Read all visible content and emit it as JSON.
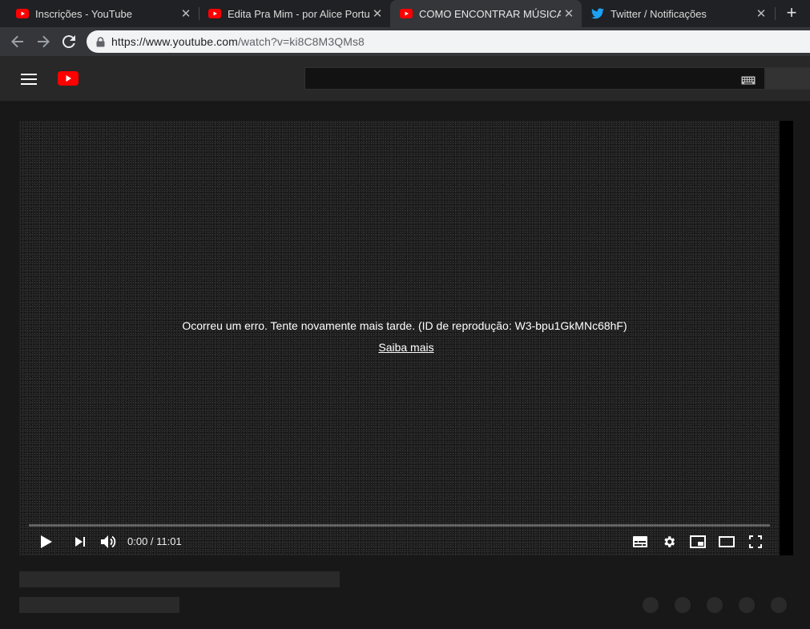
{
  "browser": {
    "tabs": [
      {
        "title": "Inscrições - YouTube",
        "icon": "youtube-icon",
        "active": false
      },
      {
        "title": "Edita Pra Mim - por Alice Portugal",
        "icon": "youtube-icon",
        "active": false
      },
      {
        "title": "COMO ENCONTRAR MÚSICAS GRÁTIS",
        "icon": "youtube-icon",
        "active": true
      },
      {
        "title": "Twitter / Notificações",
        "icon": "twitter-icon",
        "active": false
      }
    ],
    "url_host": "https://www.youtube.com",
    "url_path": "/watch?v=ki8C8M3QMs8"
  },
  "player": {
    "error_message": "Ocorreu um erro. Tente novamente mais tarde. (ID de reprodução: W3-bpu1GkMNc68hF)",
    "learn_more": "Saiba mais",
    "time": "0:00 / 11:01",
    "progress": 0
  },
  "colors": {
    "youtube_red": "#ff0000",
    "twitter_blue": "#1da1f2"
  }
}
